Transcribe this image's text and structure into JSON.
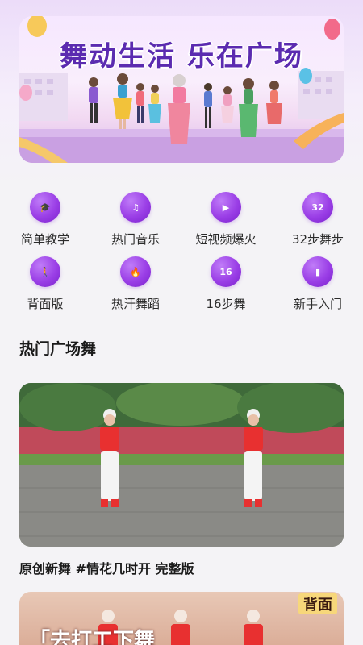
{
  "banner": {
    "title": "舞动生活 乐在广场"
  },
  "categories": [
    {
      "label": "简单教学",
      "icon": "graduation-cap-icon",
      "glyph": "🎓"
    },
    {
      "label": "热门音乐",
      "icon": "music-note-icon",
      "glyph": "♫"
    },
    {
      "label": "短视频爆火",
      "icon": "play-icon",
      "glyph": "▶"
    },
    {
      "label": "32步舞步",
      "icon": "number-32-icon",
      "glyph": "32"
    },
    {
      "label": "背面版",
      "icon": "person-icon",
      "glyph": "🚶"
    },
    {
      "label": "热汗舞蹈",
      "icon": "flame-icon",
      "glyph": "🔥"
    },
    {
      "label": "16步舞",
      "icon": "number-16-icon",
      "glyph": "16"
    },
    {
      "label": "新手入门",
      "icon": "book-icon",
      "glyph": "▮"
    }
  ],
  "section": {
    "title": "热门广场舞"
  },
  "videos": [
    {
      "title": "原创新舞 #情花几时开 完整版"
    },
    {
      "tag": "背面",
      "overlay_text": "「去打工下舞"
    }
  ],
  "colors": {
    "accent": "#9a3ee6",
    "title_purple": "#5b2bb0",
    "background": "#f4f3f6"
  }
}
